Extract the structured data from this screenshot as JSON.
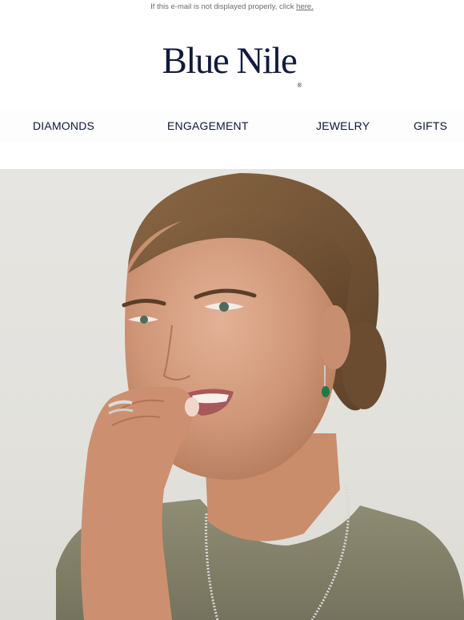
{
  "preheader": {
    "text": "If this e-mail is not displayed properly, click ",
    "link_label": "here."
  },
  "brand": {
    "name": "Blue Nile",
    "mark": "®",
    "color": "#121a3c"
  },
  "nav": {
    "items": [
      {
        "label": "DIAMONDS"
      },
      {
        "label": "ENGAGEMENT"
      },
      {
        "label": "JEWELRY"
      },
      {
        "label": "GIFTS"
      }
    ]
  },
  "hero": {
    "icon": "smiling-woman-photo"
  }
}
